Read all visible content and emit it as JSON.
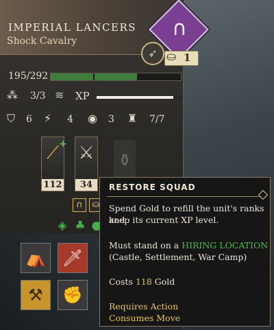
{
  "unit": {
    "name": "IMPERIAL LANCERS",
    "type": "Shock Cavalry",
    "badge_icon": "horseshoe-icon",
    "tier_count": "1"
  },
  "stats": {
    "hp": "195/292",
    "hp_fraction": 0.667,
    "squad": "3/3",
    "xp_label": "XP",
    "xp_fraction": 0.9,
    "defense": "6",
    "movement": "4",
    "vision": "3",
    "morale": "7/7"
  },
  "weapons": [
    {
      "icon": "spear-icon",
      "value": "112"
    },
    {
      "icon": "sword-icon",
      "value": "34"
    }
  ],
  "tooltip": {
    "title": "RESTORE SQUAD",
    "line1": "Spend Gold to refill the unit's ranks and",
    "line2": "keep its current XP level.",
    "must_prefix": "Must stand on a",
    "hiring_location": "HIRING LOCATION",
    "locations": "(Castle, Settlement, War Camp)",
    "costs_prefix": "Costs",
    "cost_value": "118",
    "costs_suffix": "Gold",
    "requires": "Requires Action",
    "consumes": "Consumes Move"
  },
  "colors": {
    "badge": "#7a3e92",
    "hp_green": "#3f7d3c",
    "highlight_green": "#4dbb4a",
    "highlight_gold": "#e4c65a"
  }
}
